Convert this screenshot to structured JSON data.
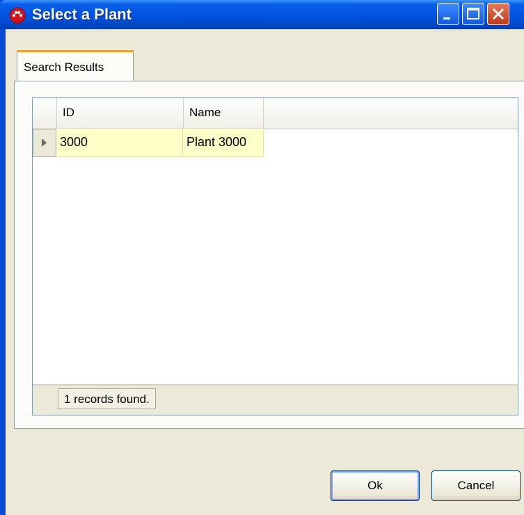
{
  "window": {
    "title": "Select a Plant"
  },
  "tabs": [
    {
      "label": "Search Results"
    }
  ],
  "grid": {
    "columns": [
      "ID",
      "Name"
    ],
    "rows": [
      {
        "id": "3000",
        "name": "Plant 3000"
      }
    ],
    "status": "1 records found."
  },
  "buttons": {
    "ok": "Ok",
    "cancel": "Cancel"
  },
  "colors": {
    "titlebar": "#0054e3",
    "selected_row": "#ffffc8",
    "tab_accent": "#f1a12f"
  }
}
